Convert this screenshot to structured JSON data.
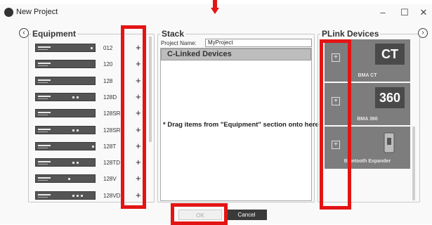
{
  "window": {
    "title": "New Project",
    "minimize": "–",
    "maximize": "☐",
    "close": "✕"
  },
  "equipment": {
    "legend": "Equipment",
    "left_nav": "‹",
    "items": [
      {
        "label": "012",
        "add": "+"
      },
      {
        "label": "120",
        "add": "+"
      },
      {
        "label": "128",
        "add": "+"
      },
      {
        "label": "128D",
        "add": "+"
      },
      {
        "label": "128SR",
        "add": "+"
      },
      {
        "label": "128SRD",
        "add": "+"
      },
      {
        "label": "128T",
        "add": "+"
      },
      {
        "label": "128TD",
        "add": "+"
      },
      {
        "label": "128V",
        "add": "+"
      },
      {
        "label": "128VD",
        "add": "+"
      }
    ]
  },
  "stack": {
    "legend": "Stack",
    "project_name_label": "Project Name:",
    "project_name_value": "MyProject",
    "group_label": "C-Linked Devices",
    "drop_hint": "* Drag items from \"Equipment\" section onto here"
  },
  "plink": {
    "legend": "PLink Devices",
    "right_nav": "›",
    "items": [
      {
        "badge": "CT",
        "name": "BMA CT",
        "add": "+"
      },
      {
        "badge": "360",
        "name": "BMA 360",
        "add": "+"
      },
      {
        "badge": "",
        "name": "Bluetooth Expander",
        "add": "+"
      }
    ]
  },
  "footer": {
    "ok_label": "OK",
    "cancel_label": "Cancel"
  },
  "colors": {
    "highlight": "#e41414",
    "card": "#7d7d7d",
    "cancel_bg": "#3a3a3a"
  }
}
